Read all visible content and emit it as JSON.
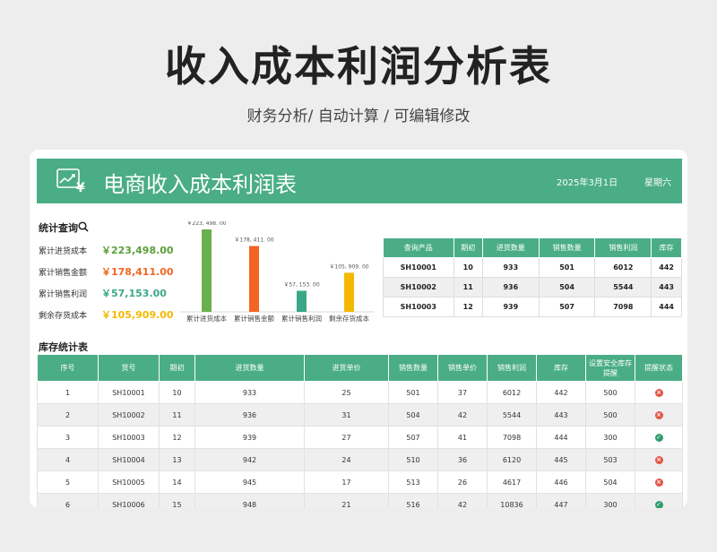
{
  "page": {
    "title": "收入成本利润分析表",
    "subtitle": "财务分析/ 自动计算 / 可编辑修改"
  },
  "banner": {
    "title": "电商收入成本利润表",
    "date": "2025年3月1日",
    "weekday": "星期六",
    "icon": "yen-chart-icon"
  },
  "stats": {
    "title": "统计查询",
    "items": [
      {
        "label": "累计进货成本",
        "value": "￥223,498.00",
        "color": "#5a9e3a"
      },
      {
        "label": "累计销售金额",
        "value": "￥178,411.00",
        "color": "#f26522"
      },
      {
        "label": "累计销售利润",
        "value": "￥57,153.00",
        "color": "#3aa888"
      },
      {
        "label": "剩余存货成本",
        "value": "￥105,909.00",
        "color": "#f5b800"
      }
    ]
  },
  "chart_data": {
    "type": "bar",
    "categories": [
      "累计进货成本",
      "累计销售金额",
      "累计销售利润",
      "剩余存货成本"
    ],
    "values": [
      223498,
      178411,
      57153,
      105909
    ],
    "data_labels": [
      "￥223, 498. 00",
      "￥178, 411. 00",
      "￥57, 153. 00",
      "￥105, 909. 00"
    ],
    "colors": [
      "#6ab04c",
      "#f26522",
      "#3aa888",
      "#f5b800"
    ],
    "ylim": [
      0,
      223498
    ],
    "title": "",
    "xlabel": "",
    "ylabel": ""
  },
  "query_table": {
    "headers": [
      "查询产品",
      "期初",
      "进货数量",
      "销售数量",
      "销售利润",
      "库存"
    ],
    "rows": [
      [
        "SH10001",
        "10",
        "933",
        "501",
        "6012",
        "442"
      ],
      [
        "SH10002",
        "11",
        "936",
        "504",
        "5544",
        "443"
      ],
      [
        "SH10003",
        "12",
        "939",
        "507",
        "7098",
        "444"
      ]
    ]
  },
  "inventory": {
    "title": "库存统计表",
    "headers": [
      "序号",
      "货号",
      "期初",
      "进货数量",
      "进货单价",
      "销售数量",
      "销售单价",
      "销售利润",
      "库存",
      "设置安全库存提醒",
      "提醒状态"
    ],
    "rows": [
      {
        "cells": [
          "1",
          "SH10001",
          "10",
          "933",
          "25",
          "501",
          "37",
          "6012",
          "442",
          "500"
        ],
        "status": "alert"
      },
      {
        "cells": [
          "2",
          "SH10002",
          "11",
          "936",
          "31",
          "504",
          "42",
          "5544",
          "443",
          "500"
        ],
        "status": "alert"
      },
      {
        "cells": [
          "3",
          "SH10003",
          "12",
          "939",
          "27",
          "507",
          "41",
          "7098",
          "444",
          "300"
        ],
        "status": "ok"
      },
      {
        "cells": [
          "4",
          "SH10004",
          "13",
          "942",
          "24",
          "510",
          "36",
          "6120",
          "445",
          "503"
        ],
        "status": "alert"
      },
      {
        "cells": [
          "5",
          "SH10005",
          "14",
          "945",
          "17",
          "513",
          "26",
          "4617",
          "446",
          "504"
        ],
        "status": "alert"
      },
      {
        "cells": [
          "6",
          "SH10006",
          "15",
          "948",
          "21",
          "516",
          "42",
          "10836",
          "447",
          "300"
        ],
        "status": "ok"
      }
    ],
    "status_colors": {
      "alert": "#e25545",
      "ok": "#2f9e6e"
    }
  },
  "colors": {
    "accent": "#4aad86"
  }
}
